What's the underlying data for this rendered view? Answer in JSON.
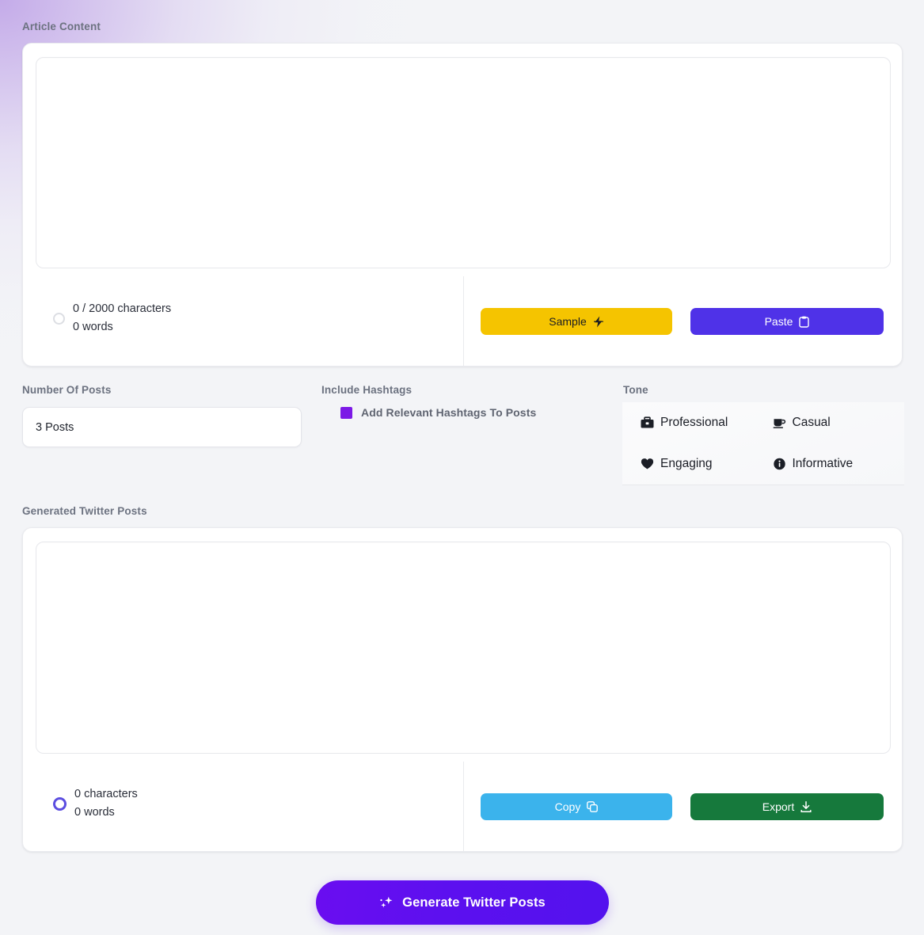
{
  "theme": {
    "background": "#f3f4f7",
    "glow": "#a77ee0",
    "label_color": "#6c7280",
    "accent_purple": "#5c10ef",
    "sample_yellow": "#f5c400",
    "paste_indigo": "#4f32e8",
    "copy_blue": "#3bb3ec",
    "export_green": "#16793c",
    "checkbox_violet": "#7c19e6",
    "ring_idle": "#dcdee3",
    "ring_active": "#5b4de0"
  },
  "article": {
    "label": "Article Content",
    "textarea_value": "",
    "textarea_placeholder": "",
    "char_count": "0 / 2000 characters",
    "word_count": "0 words",
    "sample_label": "Sample",
    "sample_icon": "lightning-bolt-icon",
    "paste_label": "Paste",
    "paste_icon": "clipboard-icon"
  },
  "options": {
    "posts": {
      "label": "Number Of Posts",
      "value": "3 Posts",
      "option_values": [
        "3 Posts"
      ]
    },
    "hashtags": {
      "label": "Include Hashtags",
      "checkbox_label": "Add Relevant Hashtags To Posts",
      "checked": true
    },
    "tone": {
      "label": "Tone",
      "items": [
        {
          "label": "Professional",
          "icon": "briefcase-icon"
        },
        {
          "label": "Casual",
          "icon": "coffee-cup-icon"
        },
        {
          "label": "Engaging",
          "icon": "heart-icon"
        },
        {
          "label": "Informative",
          "icon": "info-circle-icon"
        }
      ]
    }
  },
  "generated": {
    "label": "Generated Twitter Posts",
    "textarea_value": "",
    "textarea_placeholder": "",
    "char_count": "0 characters",
    "word_count": "0 words",
    "copy_label": "Copy",
    "copy_icon": "copy-icon",
    "export_label": "Export",
    "export_icon": "download-icon"
  },
  "generate": {
    "label": "Generate Twitter Posts",
    "icon": "sparkles-icon"
  }
}
